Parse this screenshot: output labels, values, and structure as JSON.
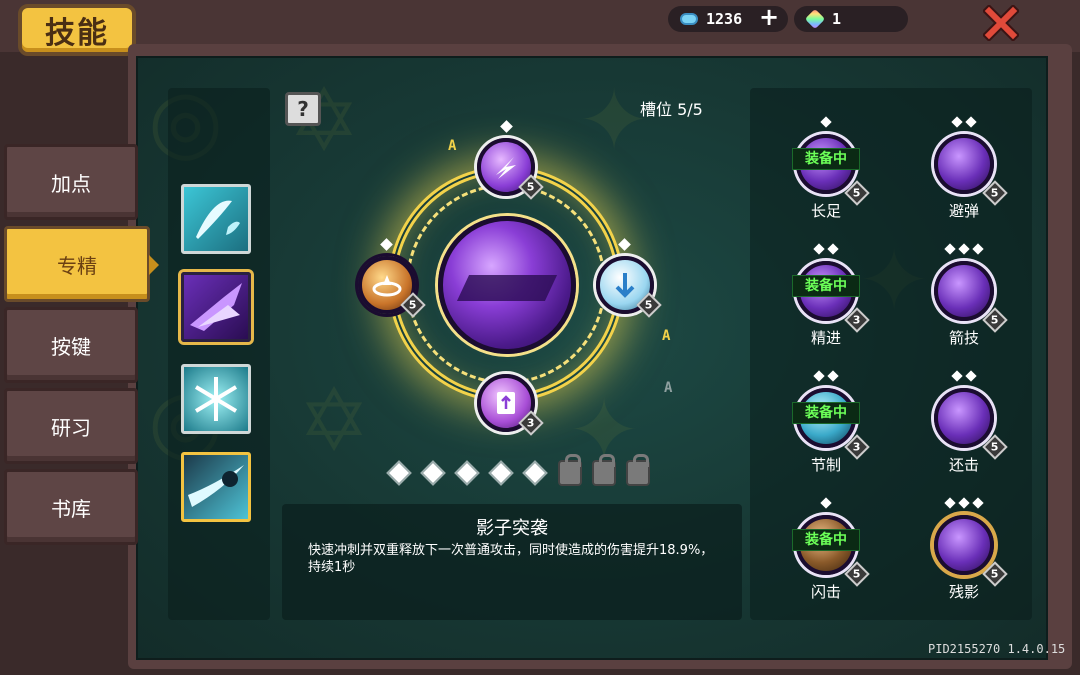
{
  "header": {
    "title": "技能",
    "currency_blue": "1236",
    "currency_rainbow": "1",
    "plus_label": "+",
    "close_icon": "close-icon"
  },
  "tabs": [
    {
      "label": "加点",
      "active": false
    },
    {
      "label": "专精",
      "active": true
    },
    {
      "label": "按键",
      "active": false
    },
    {
      "label": "研习",
      "active": false
    },
    {
      "label": "书库",
      "active": false
    }
  ],
  "help_label": "?",
  "slot_label": "槽位 5/5",
  "center": {
    "levels": {
      "top": "5",
      "left": "5",
      "right": "5",
      "bottom": "3"
    },
    "glyphs": [
      "A",
      "A",
      "A"
    ]
  },
  "progress": {
    "filled": 5,
    "locked": 3
  },
  "description": {
    "title": "影子突袭",
    "text": "快速冲刺并双重释放下一次普通攻击，同时使造成的伤害提升18.9%，持续1秒"
  },
  "skills": [
    {
      "name": "长足",
      "equipped": true,
      "equip_label": "装备中",
      "level": "5",
      "pips": 1
    },
    {
      "name": "避弹",
      "equipped": false,
      "equip_label": "",
      "level": "5",
      "pips": 2
    },
    {
      "name": "精进",
      "equipped": true,
      "equip_label": "装备中",
      "level": "3",
      "pips": 2
    },
    {
      "name": "箭技",
      "equipped": false,
      "equip_label": "",
      "level": "5",
      "pips": 3
    },
    {
      "name": "节制",
      "equipped": true,
      "equip_label": "装备中",
      "level": "3",
      "pips": 2
    },
    {
      "name": "还击",
      "equipped": false,
      "equip_label": "",
      "level": "5",
      "pips": 2
    },
    {
      "name": "闪击",
      "equipped": true,
      "equip_label": "装备中",
      "level": "5",
      "pips": 1
    },
    {
      "name": "残影",
      "equipped": false,
      "equip_label": "",
      "level": "5",
      "pips": 3
    }
  ],
  "footer": {
    "id": "PID2155270 1.4.0.15"
  },
  "colors": {
    "accent": "#f3c341",
    "equip_green": "#6cff58",
    "panel": "#173834"
  }
}
